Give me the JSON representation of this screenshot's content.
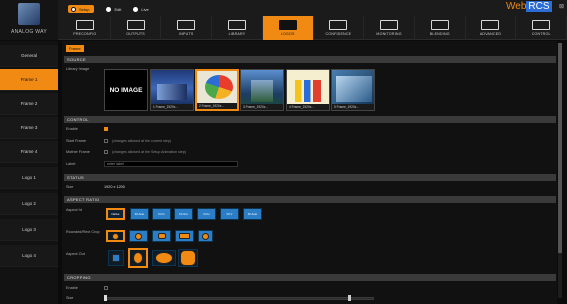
{
  "app": {
    "brand": "ANALOG WAY",
    "webrcs_a": "Web",
    "webrcs_b": "RCS",
    "window_ctl": "⊠"
  },
  "presets": [
    {
      "label": "Setup",
      "active": true
    },
    {
      "label": "Edit",
      "active": false
    },
    {
      "label": "Live",
      "active": false
    }
  ],
  "menu": [
    {
      "label": "PRECONFIG",
      "icon": "preconfig-icon"
    },
    {
      "label": "OUTPUTS",
      "icon": "outputs-icon"
    },
    {
      "label": "INPUTS",
      "icon": "inputs-icon"
    },
    {
      "label": "LIBRARY",
      "icon": "library-icon"
    },
    {
      "label": "LOGOS",
      "icon": "logos-icon",
      "active": true
    },
    {
      "label": "CONFIDENCE",
      "icon": "confidence-icon"
    },
    {
      "label": "MONITORING",
      "icon": "monitoring-icon"
    },
    {
      "label": "BLENDING",
      "icon": "blending-icon"
    },
    {
      "label": "ADVANCED",
      "icon": "advanced-icon"
    },
    {
      "label": "CONTROL",
      "icon": "control-icon"
    }
  ],
  "sidebar": [
    {
      "label": "General"
    },
    {
      "label": "Frame 1",
      "active": true
    },
    {
      "label": "Frame 2"
    },
    {
      "label": "Frame 3"
    },
    {
      "label": "Frame 4"
    },
    {
      "label": "Logo 1"
    },
    {
      "label": "Logo 2"
    },
    {
      "label": "Logo 3"
    },
    {
      "label": "Logo 4"
    }
  ],
  "main": {
    "tag": "Frame",
    "source": {
      "title": "SOURCE",
      "library_label": "Library Image",
      "no_image": "NO IMAGE",
      "thumbs": [
        {
          "caption": "1 Frame_1920x..."
        },
        {
          "caption": "2 Frame_1920x...",
          "selected": true
        },
        {
          "caption": "3 Frame_1920x..."
        },
        {
          "caption": "4 Frame_1920x..."
        },
        {
          "caption": "5 Frame_1920x..."
        }
      ]
    },
    "control": {
      "title": "CONTROL",
      "rows": [
        {
          "label": "Enable",
          "checked": true,
          "hint": ""
        },
        {
          "label": "Start Frame",
          "checked": false,
          "hint": "(changes allowed at the current step)"
        },
        {
          "label": "Mother Frame",
          "checked": false,
          "hint": "(changes allowed at the Setup Animation step)"
        }
      ],
      "label_row": {
        "label": "Label",
        "value": "enter label"
      }
    },
    "status": {
      "title": "STATUS",
      "size_label": "Size",
      "size_value": "1920 x 1200"
    },
    "aspect": {
      "title": "ASPECT RATIO",
      "ratio_label": "Aspect ht",
      "ratio_buttons": [
        "Native",
        "Fit\nAuto",
        "Fit\nIn",
        "Fit\nOut",
        "Fit H",
        "Fit V",
        "Fit\nAuto"
      ],
      "round_label": "Rounded/Rect Crop",
      "round_count": 5,
      "shape_label": "Aspect Out"
    },
    "cropping": {
      "title": "CROPPING",
      "enable_label": "Enable",
      "size_label": "Size"
    }
  }
}
